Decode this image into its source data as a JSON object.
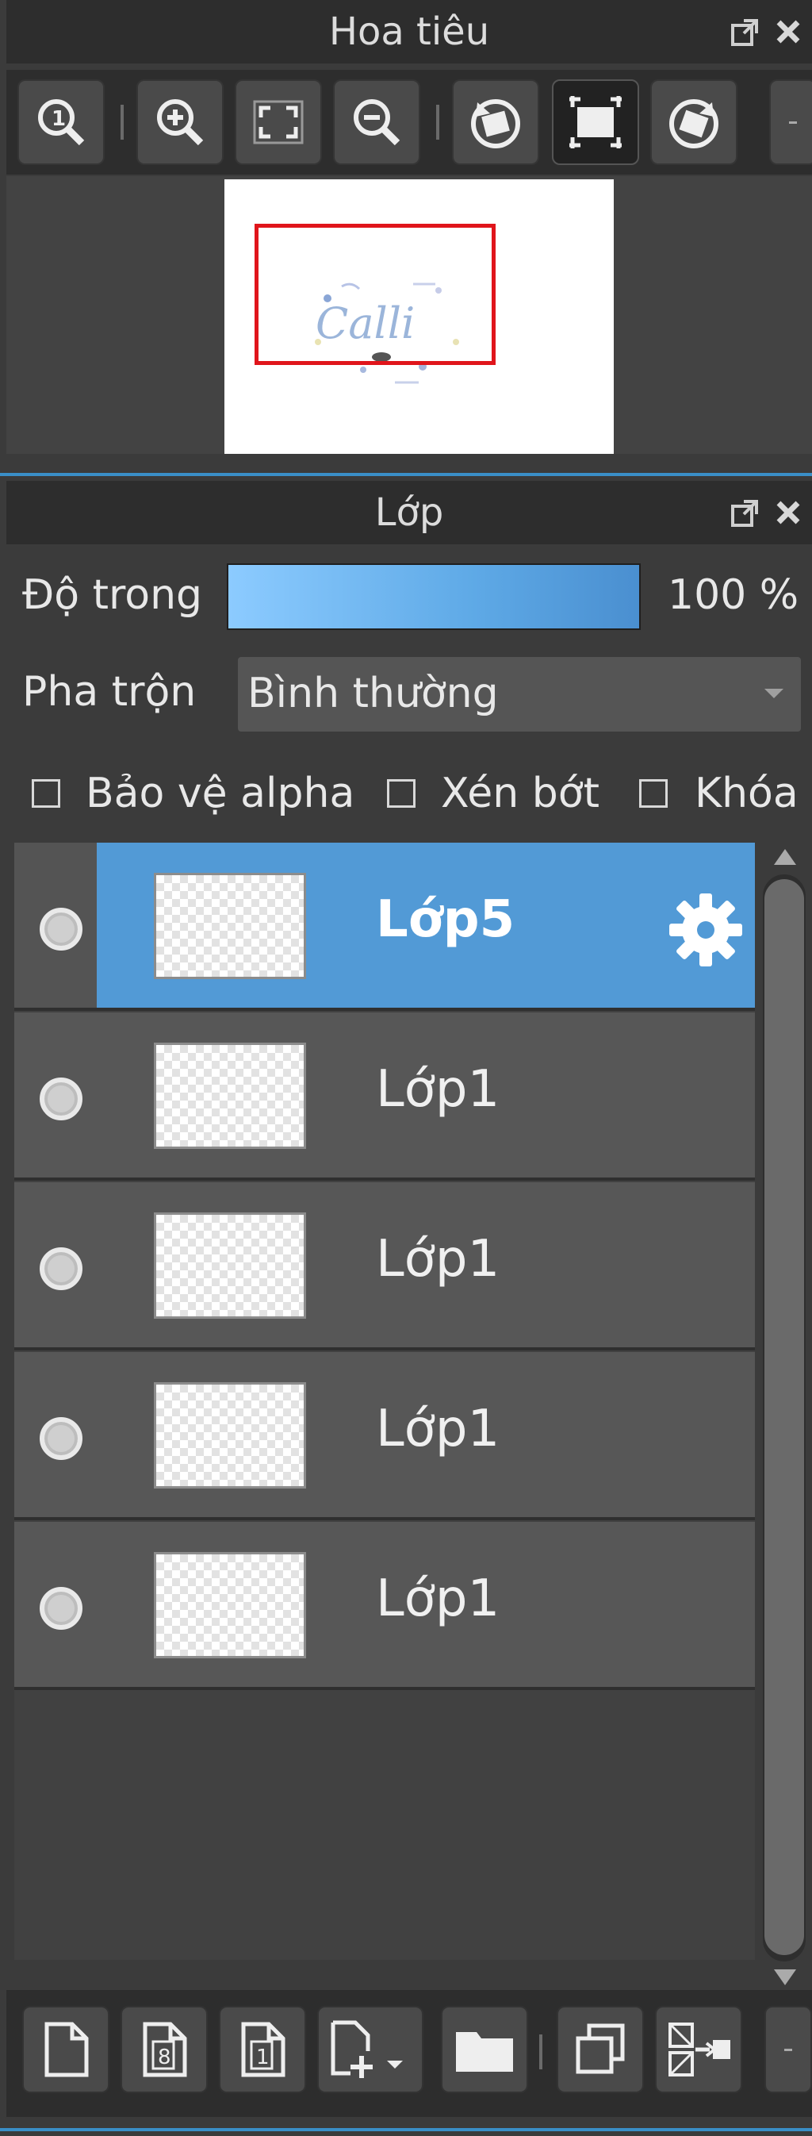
{
  "navigator": {
    "title": "Hoa tiêu",
    "toolbar": [
      {
        "icon": "zoom-actual-icon"
      },
      {
        "icon": "zoom-in-icon"
      },
      {
        "icon": "fit-screen-icon"
      },
      {
        "icon": "zoom-out-icon"
      },
      {
        "icon": "rotate-left-icon"
      },
      {
        "icon": "fit-canvas-icon",
        "active": true
      },
      {
        "icon": "rotate-right-icon"
      }
    ],
    "preview_text": "Calli"
  },
  "layers": {
    "title": "Lớp",
    "opacity_label": "Độ trong",
    "opacity_value": "100 %",
    "opacity_fraction": 1.0,
    "blend_label": "Pha trộn",
    "blend_value": "Bình thường",
    "checkboxes": [
      {
        "label": "Bảo vệ alpha",
        "checked": false
      },
      {
        "label": "Xén bớt",
        "checked": false
      },
      {
        "label": "Khóa",
        "checked": false
      }
    ],
    "items": [
      {
        "name": "Lớp5",
        "selected": true,
        "visible": true
      },
      {
        "name": "Lớp1",
        "selected": false,
        "visible": true
      },
      {
        "name": "Lớp1",
        "selected": false,
        "visible": true
      },
      {
        "name": "Lớp1",
        "selected": false,
        "visible": true
      },
      {
        "name": "Lớp1",
        "selected": false,
        "visible": true
      }
    ],
    "bottom_toolbar": [
      {
        "icon": "new-layer-icon"
      },
      {
        "icon": "new-8bit-layer-icon",
        "text": "8"
      },
      {
        "icon": "new-1bit-layer-icon",
        "text": "1"
      },
      {
        "icon": "add-layer-dropdown-icon"
      },
      {
        "icon": "folder-icon"
      },
      {
        "icon": "duplicate-layer-icon"
      },
      {
        "icon": "merge-layer-icon"
      }
    ]
  },
  "colors": {
    "accent": "#529ad6",
    "selection_rect": "#e0151b",
    "panel_bg": "#2d2d2d"
  }
}
